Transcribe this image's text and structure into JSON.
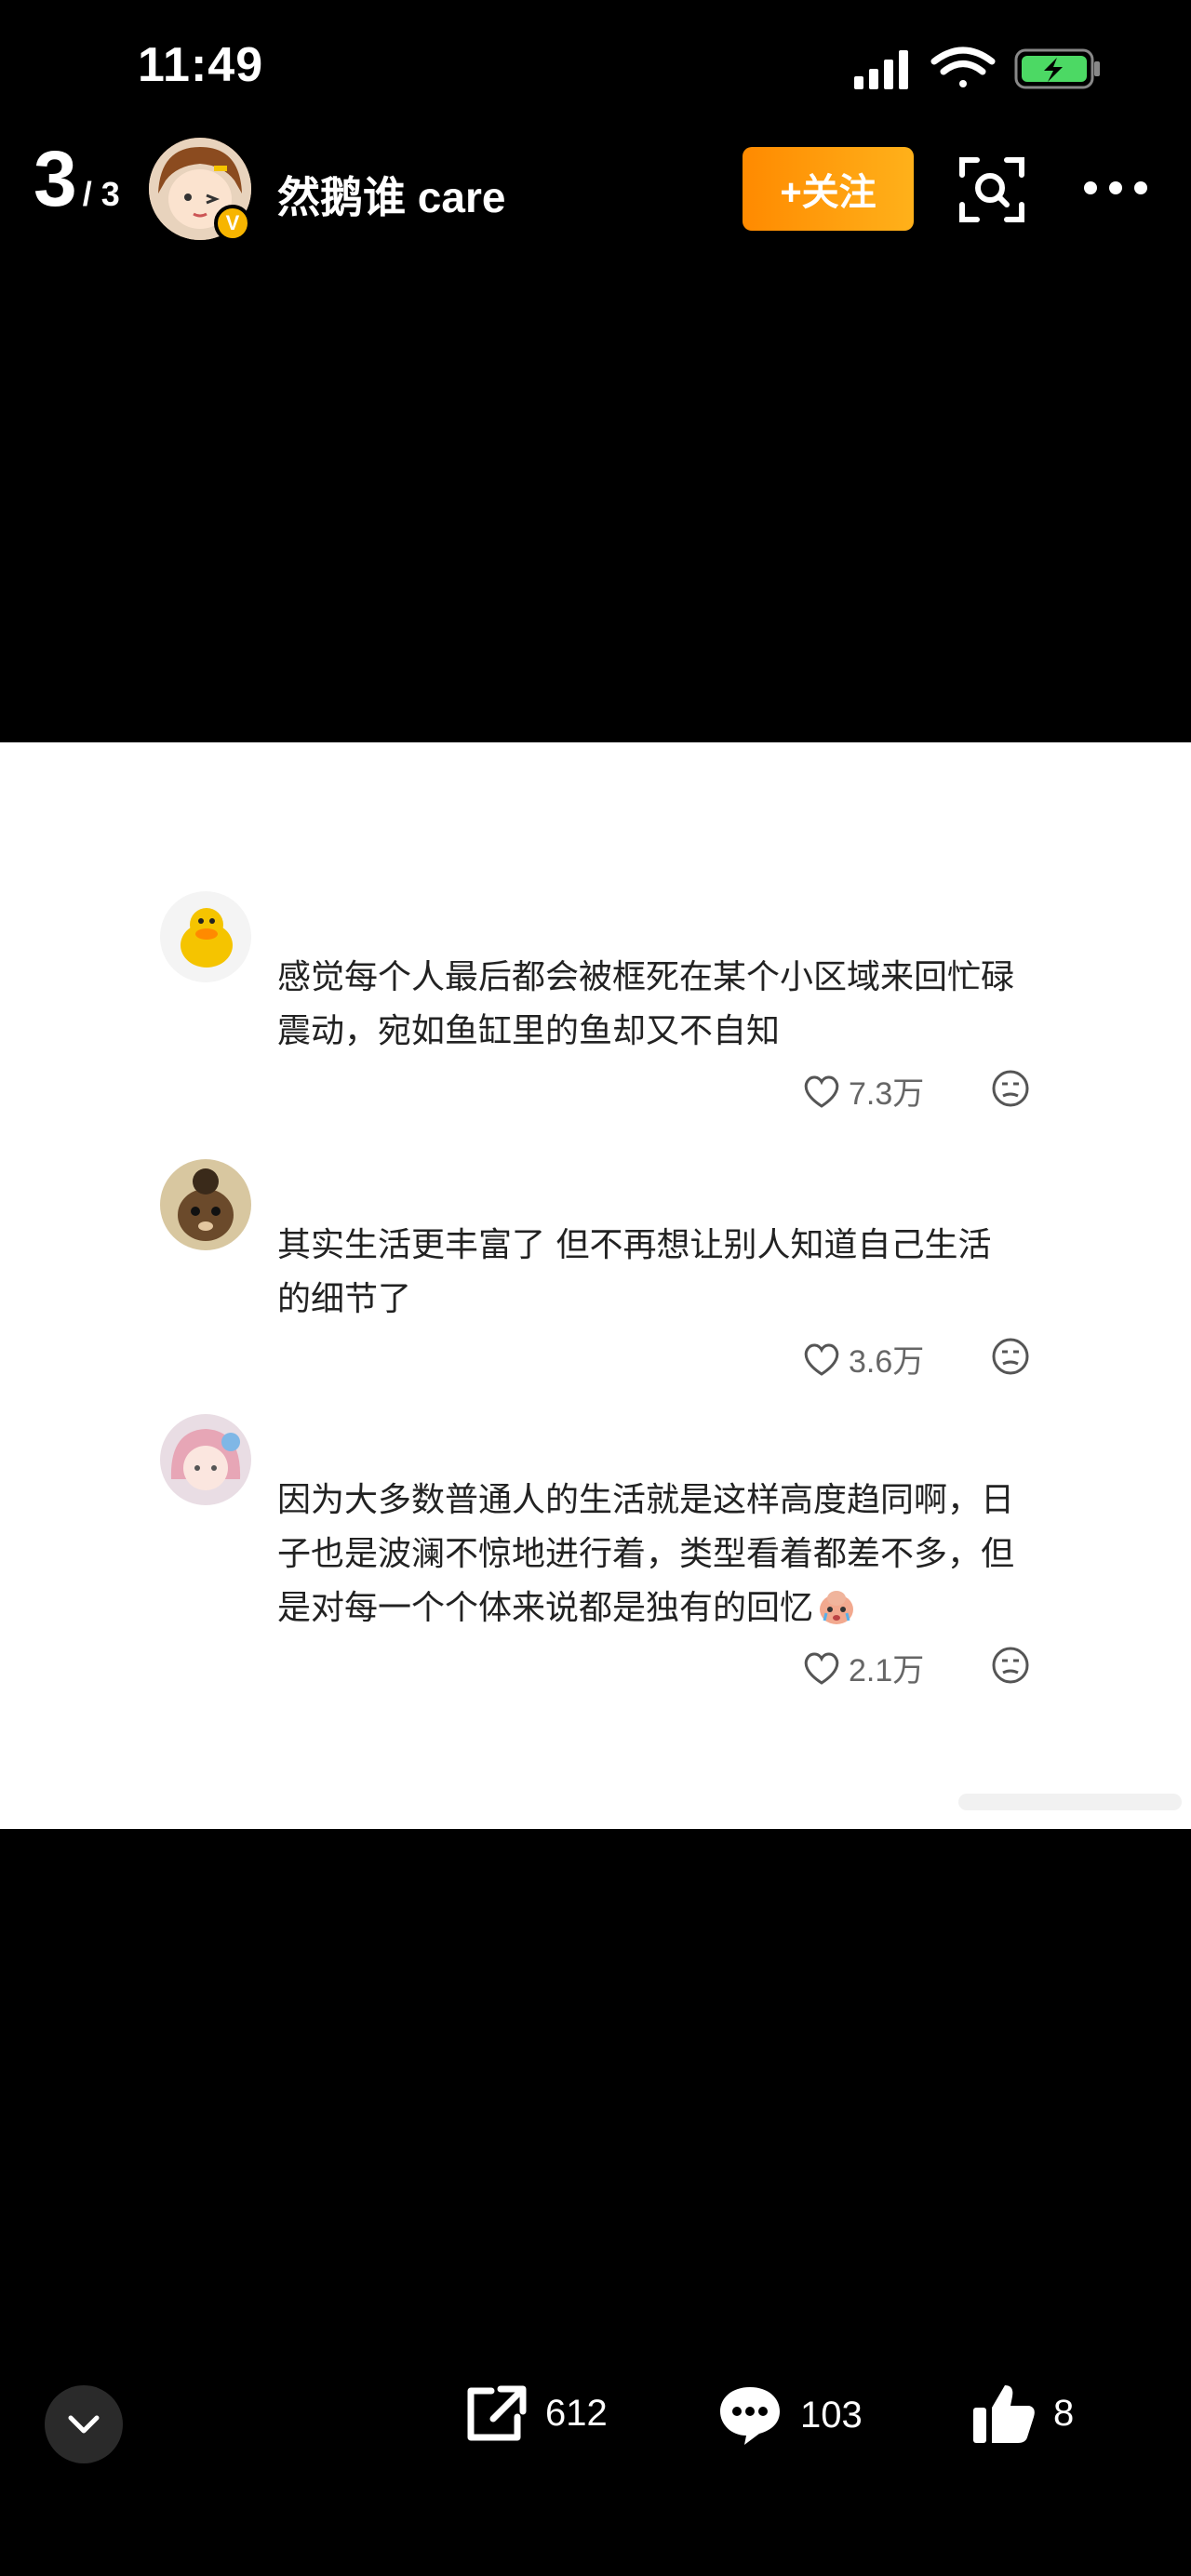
{
  "status_bar": {
    "time": "11:49"
  },
  "header": {
    "page_current": "3",
    "page_total": "/ 3",
    "username": "然鹅谁 care",
    "verified_badge": "V",
    "follow_label": "+关注"
  },
  "comments": [
    {
      "text": "感觉每个人最后都会被框死在某个小区域来回忙碌震动，宛如鱼缸里的鱼却又不自知",
      "likes": "7.3万"
    },
    {
      "text": "其实生活更丰富了 但不再想让别人知道自己生活的细节了",
      "likes": "3.6万"
    },
    {
      "text": "因为大多数普通人的生活就是这样高度趋同啊，日子也是波澜不惊地进行着，类型看着都差不多，但是对每一个个体来说都是独有的回忆",
      "likes": "2.1万"
    }
  ],
  "bottom_bar": {
    "share_count": "612",
    "comment_count": "103",
    "like_count": "8"
  },
  "colors": {
    "follow_start": "#ff8a00",
    "follow_end": "#ffb11a",
    "verified": "#f7b500",
    "battery": "#4cd964"
  }
}
